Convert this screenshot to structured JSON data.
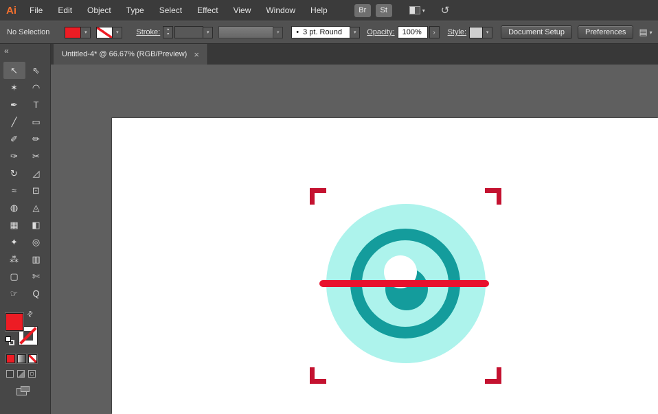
{
  "menu_bar": {
    "logo": "Ai",
    "items": [
      "File",
      "Edit",
      "Object",
      "Type",
      "Select",
      "Effect",
      "View",
      "Window",
      "Help"
    ],
    "bridge_button": "Br",
    "stock_button": "St"
  },
  "control_bar": {
    "no_selection_label": "No Selection",
    "stroke_label": "Stroke:",
    "brush_preview": "•",
    "brush_value": "3 pt. Round",
    "opacity_label": "Opacity:",
    "opacity_value": "100%",
    "opacity_more": "›",
    "style_label": "Style:",
    "document_setup_button": "Document Setup",
    "preferences_button": "Preferences",
    "caret": "▾",
    "spinner_up": "▴",
    "spinner_down": "▾",
    "align_glyph": "▤"
  },
  "tools_panel": {
    "collapse_label": "«"
  },
  "document_tab": {
    "title": "Untitled-4* @ 66.67% (RGB/Preview)",
    "close": "×"
  },
  "tools": [
    {
      "name": "selection",
      "glyph": "↖",
      "active": true
    },
    {
      "name": "direct-selection",
      "glyph": "⇖"
    },
    {
      "name": "magic-wand",
      "glyph": "✶"
    },
    {
      "name": "lasso",
      "glyph": "◠"
    },
    {
      "name": "pen",
      "glyph": "✒"
    },
    {
      "name": "type",
      "glyph": "T"
    },
    {
      "name": "line-segment",
      "glyph": "╱"
    },
    {
      "name": "rectangle",
      "glyph": "▭"
    },
    {
      "name": "paintbrush",
      "glyph": "✐"
    },
    {
      "name": "pencil",
      "glyph": "✏"
    },
    {
      "name": "blob-brush",
      "glyph": "✑"
    },
    {
      "name": "scissors",
      "glyph": "✂"
    },
    {
      "name": "rotate",
      "glyph": "↻"
    },
    {
      "name": "scale",
      "glyph": "◿"
    },
    {
      "name": "width",
      "glyph": "≈"
    },
    {
      "name": "free-transform",
      "glyph": "⊡"
    },
    {
      "name": "shape-builder",
      "glyph": "◍"
    },
    {
      "name": "perspective-grid",
      "glyph": "◬"
    },
    {
      "name": "mesh",
      "glyph": "▦"
    },
    {
      "name": "gradient",
      "glyph": "◧"
    },
    {
      "name": "eyedropper",
      "glyph": "✦"
    },
    {
      "name": "blend",
      "glyph": "◎"
    },
    {
      "name": "symbol-sprayer",
      "glyph": "⁂"
    },
    {
      "name": "column-graph",
      "glyph": "▥"
    },
    {
      "name": "artboard",
      "glyph": "▢"
    },
    {
      "name": "slice",
      "glyph": "✄"
    },
    {
      "name": "hand",
      "glyph": "☞"
    },
    {
      "name": "zoom",
      "glyph": "Q"
    }
  ],
  "icons": {
    "swap_fill_stroke": "⇄",
    "sync": "↺"
  },
  "colors": {
    "fill_red": "#ed1c24",
    "eye_light": "#adf3ec",
    "eye_teal": "#149c9c",
    "line_red": "#e8112d",
    "crop_red": "#c41230",
    "logo_orange": "#f4702e"
  }
}
